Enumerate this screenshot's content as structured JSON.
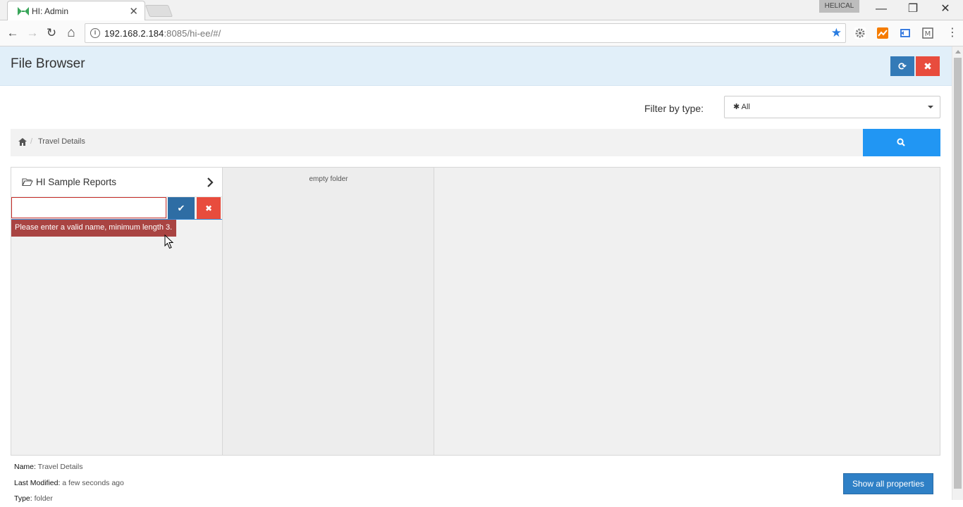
{
  "browser": {
    "tab_title": "HI: Admin",
    "tab_close": "✕",
    "profile_name": "HELICAL",
    "url_host": "192.168.2.184",
    "url_rest": ":8085/hi-ee/#/",
    "window": {
      "minimize": "—",
      "restore": "❐",
      "close": "✕"
    },
    "nav": {
      "back": "←",
      "forward": "→",
      "reload": "↻",
      "home": "⌂"
    },
    "info": "i",
    "star": "★",
    "menu": "⋮",
    "extensions": [
      "gear-extension",
      "analytics-extension",
      "bookmark-extension",
      "metamask-extension"
    ]
  },
  "app": {
    "title": "File Browser",
    "refresh_icon": "⟳",
    "close_icon": "✖"
  },
  "filter": {
    "label": "Filter by type:",
    "selected": "✱ All"
  },
  "breadcrumb": {
    "separator": "/",
    "items": [
      "Travel Details"
    ]
  },
  "columns": {
    "col1": {
      "folder_name": "HI Sample Reports",
      "rename_value": "",
      "ok_icon": "✔",
      "cancel_icon": "✖",
      "error": "Please enter a valid name, minimum length 3."
    },
    "col2": {
      "empty_text": "empty folder"
    }
  },
  "properties": {
    "name_label": "Name:",
    "name_value": "Travel Details",
    "modified_label": "Last Modified:",
    "modified_value": "a few seconds ago",
    "type_label": "Type:",
    "type_value": "folder",
    "show_all_button": "Show all properties"
  },
  "colors": {
    "header_bg": "#e1eff9",
    "primary": "#337ab7",
    "danger": "#e84c3d",
    "search": "#2196f3",
    "error_bg": "#a94442"
  }
}
